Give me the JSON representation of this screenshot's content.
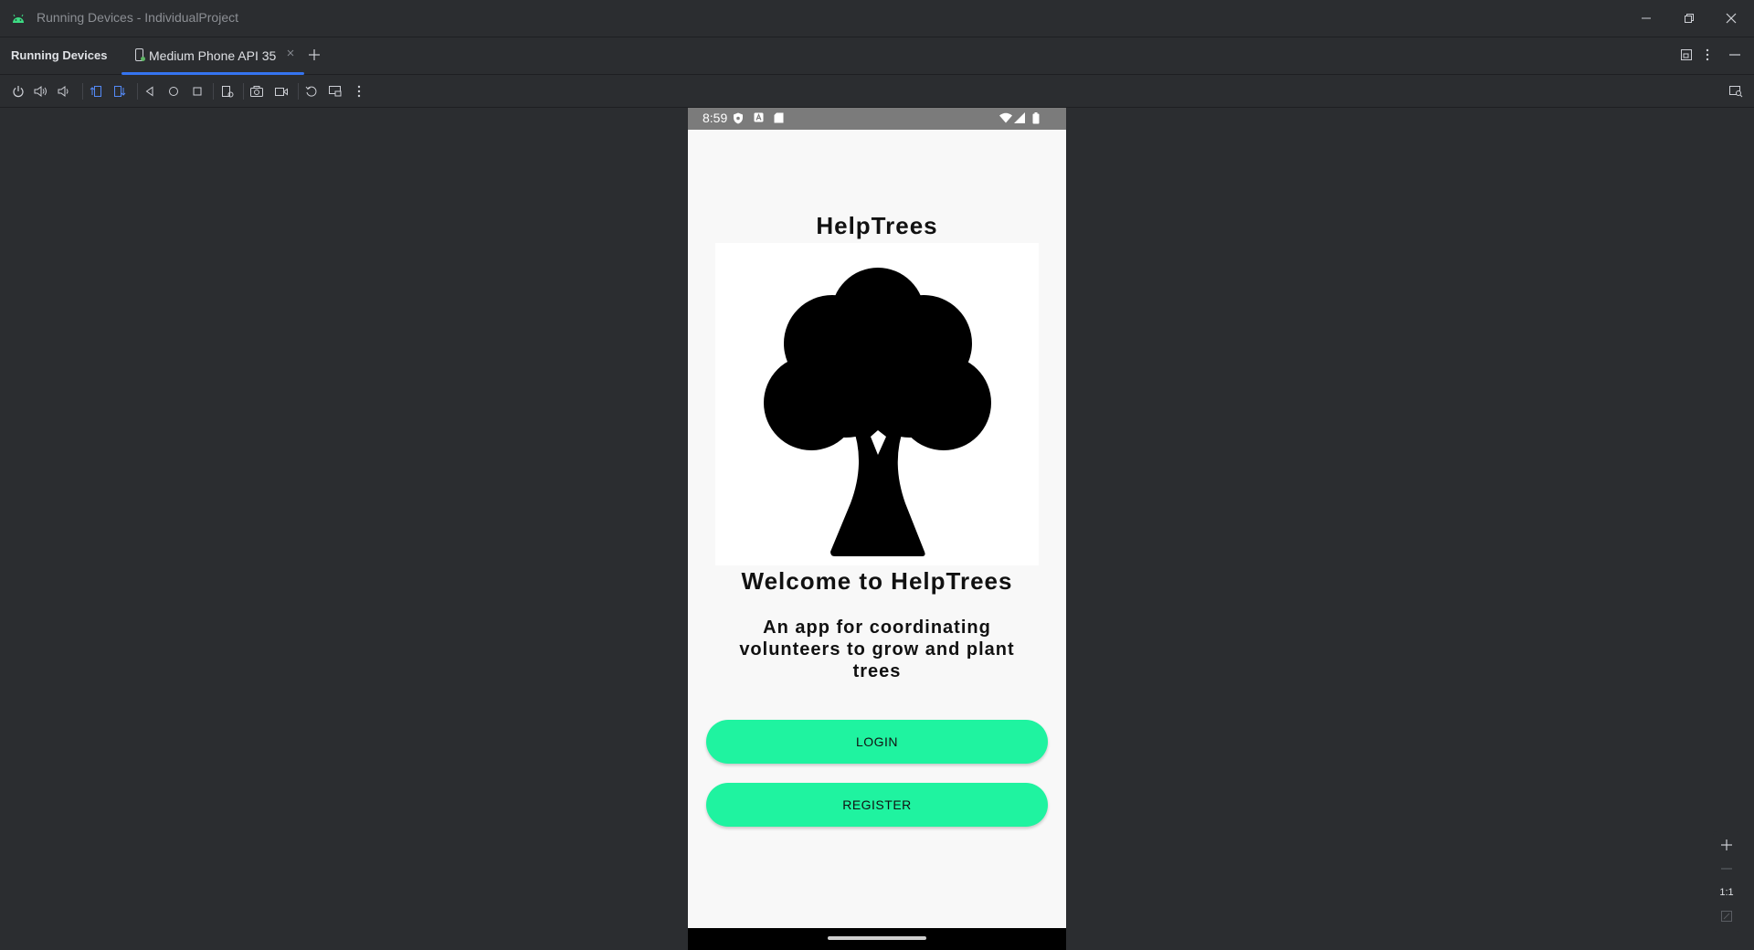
{
  "window": {
    "title": "Running Devices - IndividualProject",
    "app_icon": "android-icon",
    "controls": [
      "minimize-icon",
      "restore-icon",
      "close-icon"
    ]
  },
  "tool_window": {
    "title": "Running Devices",
    "tabs": [
      {
        "label": "Medium Phone API 35",
        "icon": "device-icon",
        "active": true
      }
    ],
    "accent_color": "#3574f0"
  },
  "toolbar": {
    "buttons": [
      "power-icon",
      "volume-up-icon",
      "volume-down-icon",
      "rotate-left-icon",
      "rotate-right-icon",
      "back-icon",
      "home-icon",
      "overview-icon",
      "fold-icon",
      "screenshot-icon",
      "screen-record-icon",
      "reset-icon",
      "snapshot-icon",
      "more-options-icon"
    ]
  },
  "device": {
    "status_bar": {
      "time": "8:59",
      "icons": [
        "shield-icon",
        "a-icon",
        "sd-card-icon",
        "wifi-icon",
        "signal-icon",
        "battery-icon"
      ]
    },
    "app": {
      "title": "HelpTrees",
      "image": "tree-icon",
      "welcome": "Welcome to HelpTrees",
      "description": "An app for coordinating volunteers to grow and plant trees",
      "login_label": "LOGIN",
      "register_label": "REGISTER",
      "button_color": "#1ff3a0"
    }
  },
  "zoom": {
    "actual_size_label": "1:1"
  }
}
